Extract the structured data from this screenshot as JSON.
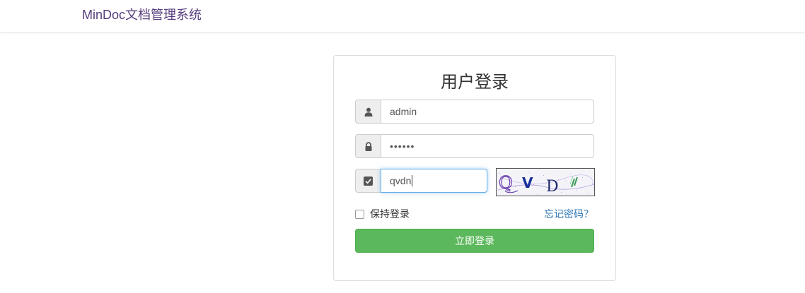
{
  "header": {
    "brand": "MinDoc文档管理系统"
  },
  "login": {
    "title": "用户登录",
    "username": {
      "value": "admin",
      "icon": "user-icon"
    },
    "password": {
      "value": "••••••",
      "icon": "lock-icon"
    },
    "captcha": {
      "value": "qvdn",
      "icon": "check-square-icon",
      "image_text": "QVD"
    },
    "remember_label": "保持登录",
    "remember_checked": false,
    "forgot_label": "忘记密码？",
    "submit_label": "立即登录"
  },
  "colors": {
    "brand": "#563d7c",
    "link": "#337ab7",
    "success": "#5cb85c",
    "focus": "#66afe9"
  }
}
